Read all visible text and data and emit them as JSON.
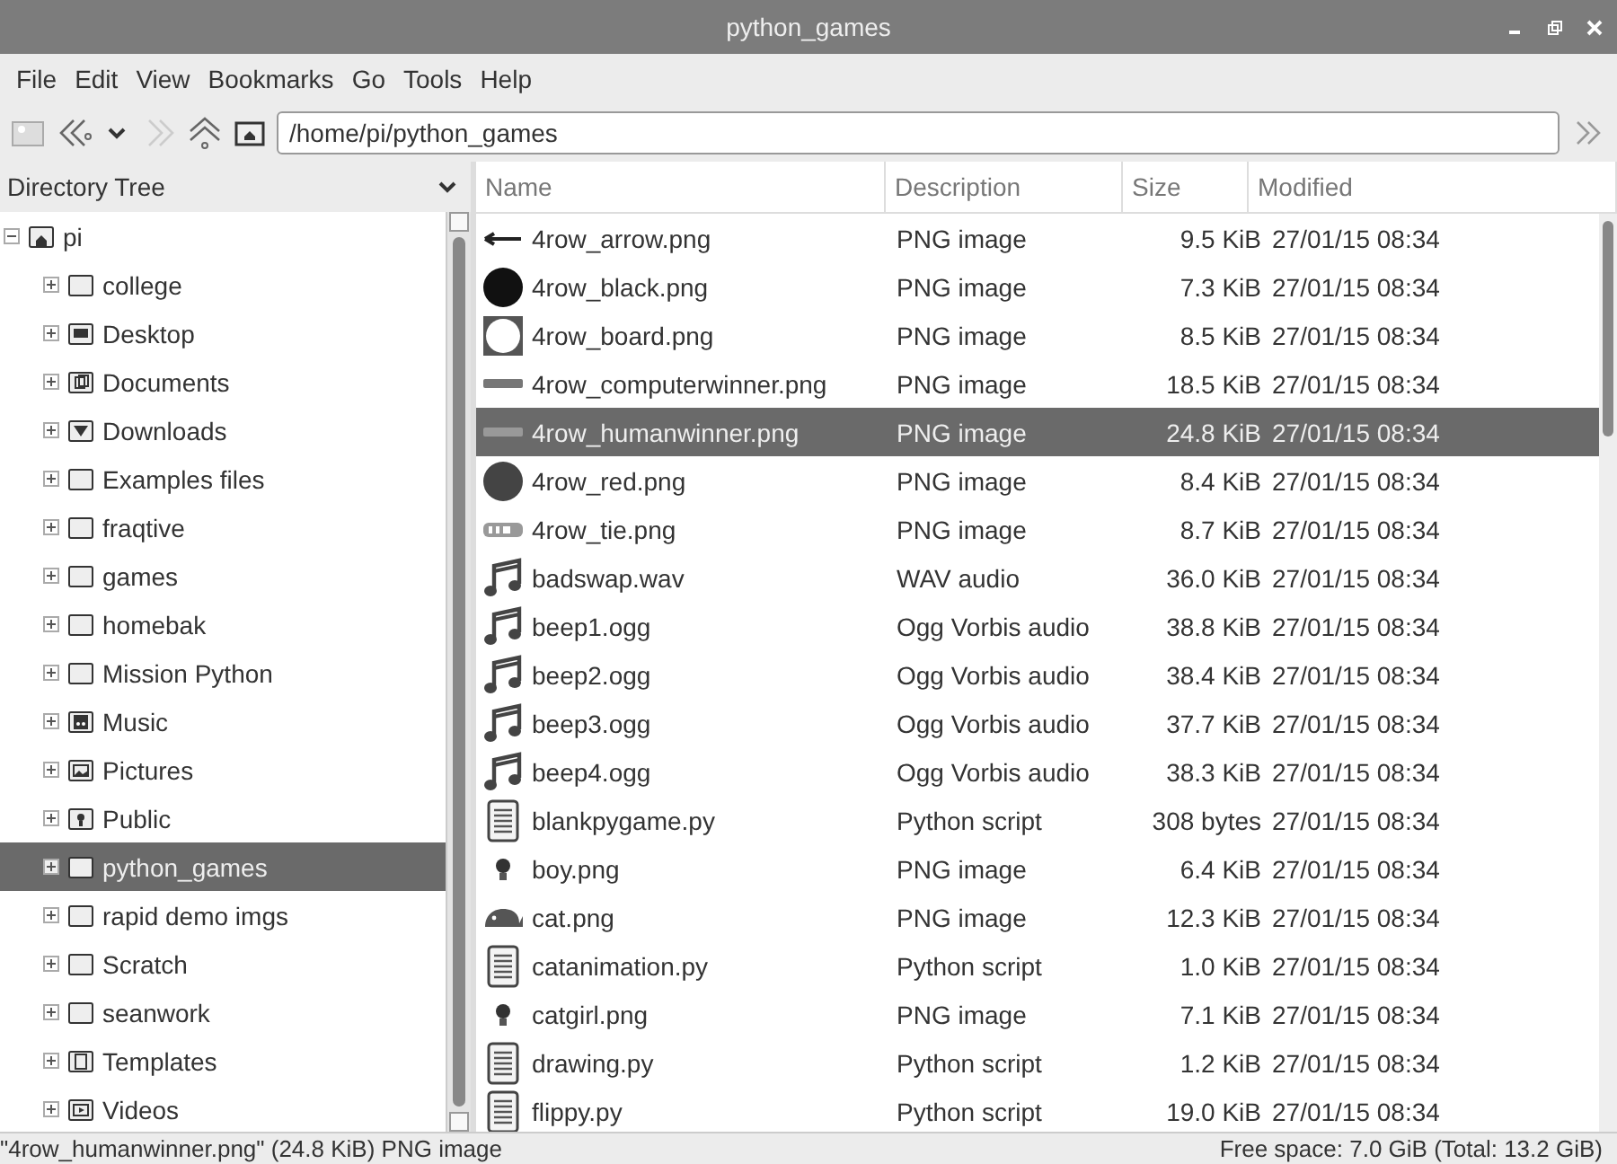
{
  "window": {
    "title": "python_games"
  },
  "menu": [
    "File",
    "Edit",
    "View",
    "Bookmarks",
    "Go",
    "Tools",
    "Help"
  ],
  "toolbar": {
    "path": "/home/pi/python_games",
    "forward_disabled": true
  },
  "sidebar": {
    "title": "Directory Tree",
    "tree": [
      {
        "label": "pi",
        "kind": "home",
        "expanded": true,
        "selected": false,
        "children": [
          {
            "label": "college",
            "kind": "plain",
            "expanded": false,
            "selected": false
          },
          {
            "label": "Desktop",
            "kind": "desktop",
            "expanded": false,
            "selected": false
          },
          {
            "label": "Documents",
            "kind": "documents",
            "expanded": false,
            "selected": false
          },
          {
            "label": "Downloads",
            "kind": "downloads",
            "expanded": false,
            "selected": false
          },
          {
            "label": "Examples files",
            "kind": "plain",
            "expanded": false,
            "selected": false
          },
          {
            "label": "fraqtive",
            "kind": "plain",
            "expanded": false,
            "selected": false
          },
          {
            "label": "games",
            "kind": "plain",
            "expanded": false,
            "selected": false
          },
          {
            "label": "homebak",
            "kind": "plain",
            "expanded": false,
            "selected": false
          },
          {
            "label": "Mission Python",
            "kind": "plain",
            "expanded": false,
            "selected": false
          },
          {
            "label": "Music",
            "kind": "music",
            "expanded": false,
            "selected": false
          },
          {
            "label": "Pictures",
            "kind": "pictures",
            "expanded": false,
            "selected": false
          },
          {
            "label": "Public",
            "kind": "public",
            "expanded": false,
            "selected": false
          },
          {
            "label": "python_games",
            "kind": "plain",
            "expanded": false,
            "selected": true
          },
          {
            "label": "rapid demo imgs",
            "kind": "plain",
            "expanded": false,
            "selected": false
          },
          {
            "label": "Scratch",
            "kind": "plain",
            "expanded": false,
            "selected": false
          },
          {
            "label": "seanwork",
            "kind": "plain",
            "expanded": false,
            "selected": false
          },
          {
            "label": "Templates",
            "kind": "templates",
            "expanded": false,
            "selected": false
          },
          {
            "label": "Videos",
            "kind": "videos",
            "expanded": false,
            "selected": false
          }
        ]
      }
    ]
  },
  "table": {
    "columns": [
      "Name",
      "Description",
      "Size",
      "Modified"
    ],
    "rows": [
      {
        "kind": "arrow",
        "name": "4row_arrow.png",
        "description": "PNG image",
        "size": "9.5 KiB",
        "modified": "27/01/15 08:34",
        "selected": false
      },
      {
        "kind": "disc",
        "name": "4row_black.png",
        "description": "PNG image",
        "size": "7.3 KiB",
        "modified": "27/01/15 08:34",
        "selected": false
      },
      {
        "kind": "board",
        "name": "4row_board.png",
        "description": "PNG image",
        "size": "8.5 KiB",
        "modified": "27/01/15 08:34",
        "selected": false
      },
      {
        "kind": "banner",
        "name": "4row_computerwinner.png",
        "description": "PNG image",
        "size": "18.5 KiB",
        "modified": "27/01/15 08:34",
        "selected": false
      },
      {
        "kind": "banner",
        "name": "4row_humanwinner.png",
        "description": "PNG image",
        "size": "24.8 KiB",
        "modified": "27/01/15 08:34",
        "selected": true
      },
      {
        "kind": "disc",
        "name": "4row_red.png",
        "description": "PNG image",
        "size": "8.4 KiB",
        "modified": "27/01/15 08:34",
        "selected": false
      },
      {
        "kind": "tile",
        "name": "4row_tie.png",
        "description": "PNG image",
        "size": "8.7 KiB",
        "modified": "27/01/15 08:34",
        "selected": false
      },
      {
        "kind": "audio",
        "name": "badswap.wav",
        "description": "WAV audio",
        "size": "36.0 KiB",
        "modified": "27/01/15 08:34",
        "selected": false
      },
      {
        "kind": "audio",
        "name": "beep1.ogg",
        "description": "Ogg Vorbis audio",
        "size": "38.8 KiB",
        "modified": "27/01/15 08:34",
        "selected": false
      },
      {
        "kind": "audio",
        "name": "beep2.ogg",
        "description": "Ogg Vorbis audio",
        "size": "38.4 KiB",
        "modified": "27/01/15 08:34",
        "selected": false
      },
      {
        "kind": "audio",
        "name": "beep3.ogg",
        "description": "Ogg Vorbis audio",
        "size": "37.7 KiB",
        "modified": "27/01/15 08:34",
        "selected": false
      },
      {
        "kind": "audio",
        "name": "beep4.ogg",
        "description": "Ogg Vorbis audio",
        "size": "38.3 KiB",
        "modified": "27/01/15 08:34",
        "selected": false
      },
      {
        "kind": "script",
        "name": "blankpygame.py",
        "description": "Python script",
        "size": "308 bytes",
        "modified": "27/01/15 08:34",
        "selected": false
      },
      {
        "kind": "sprite",
        "name": "boy.png",
        "description": "PNG image",
        "size": "6.4 KiB",
        "modified": "27/01/15 08:34",
        "selected": false
      },
      {
        "kind": "cat",
        "name": "cat.png",
        "description": "PNG image",
        "size": "12.3 KiB",
        "modified": "27/01/15 08:34",
        "selected": false
      },
      {
        "kind": "script",
        "name": "catanimation.py",
        "description": "Python script",
        "size": "1.0 KiB",
        "modified": "27/01/15 08:34",
        "selected": false
      },
      {
        "kind": "sprite",
        "name": "catgirl.png",
        "description": "PNG image",
        "size": "7.1 KiB",
        "modified": "27/01/15 08:34",
        "selected": false
      },
      {
        "kind": "script",
        "name": "drawing.py",
        "description": "Python script",
        "size": "1.2 KiB",
        "modified": "27/01/15 08:34",
        "selected": false
      },
      {
        "kind": "script",
        "name": "flippy.py",
        "description": "Python script",
        "size": "19.0 KiB",
        "modified": "27/01/15 08:34",
        "selected": false
      }
    ]
  },
  "status_bar": {
    "selection": "\"4row_humanwinner.png\" (24.8 KiB) PNG image",
    "free_space": "Free space: 7.0 GiB (Total: 13.2 GiB)"
  }
}
